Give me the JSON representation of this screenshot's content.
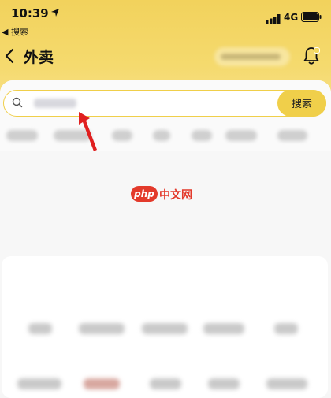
{
  "status_bar": {
    "time": "10:39",
    "back_to_app": "◀ 搜索",
    "network": "4G"
  },
  "nav": {
    "title": "外卖"
  },
  "search": {
    "value": "",
    "placeholder": "",
    "button_label": "搜索"
  },
  "watermark": {
    "badge": "php",
    "text": "中文网"
  },
  "colors": {
    "header_yellow": "#f2d25c",
    "accent_yellow": "#f0cf4a",
    "annotation_red": "#e02020",
    "watermark_red": "#e33a2b"
  },
  "icons": [
    "location-arrow-icon",
    "signal-icon",
    "battery-icon",
    "back-chevron-icon",
    "bell-icon",
    "search-icon"
  ]
}
